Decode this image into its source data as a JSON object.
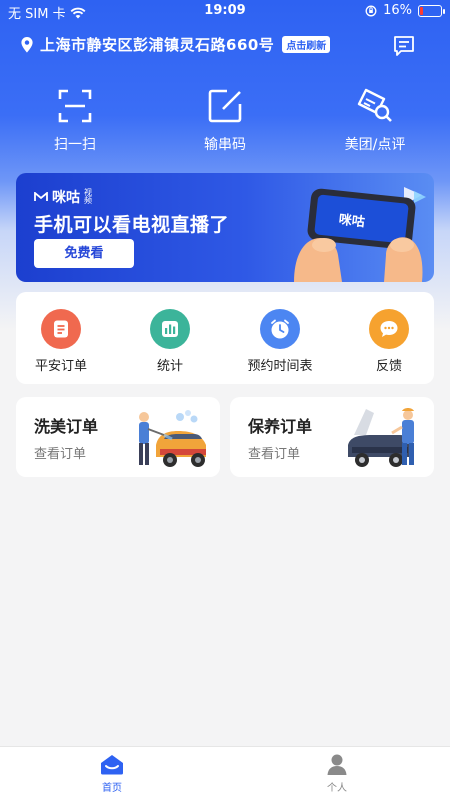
{
  "status": {
    "carrier": "无 SIM 卡",
    "time": "19:09",
    "battery": "16%",
    "battery_level": 0.16
  },
  "location": {
    "address": "上海市静安区彭浦镇灵石路660号",
    "refresh_label": "点击刷新"
  },
  "quick_actions": [
    {
      "label": "扫一扫",
      "icon": "scan-icon"
    },
    {
      "label": "输串码",
      "icon": "edit-code-icon"
    },
    {
      "label": "美团/点评",
      "icon": "voucher-search-icon"
    }
  ],
  "banner": {
    "brand": "咪咕",
    "brand_sub": "视频",
    "title": "手机可以看电视直播了",
    "button_label": "免费看",
    "phone_brand": "咪咕"
  },
  "tools": [
    {
      "label": "平安订单",
      "icon": "document-icon",
      "color": "#f0694f"
    },
    {
      "label": "统计",
      "icon": "bar-chart-icon",
      "color": "#3cb49a"
    },
    {
      "label": "预约时间表",
      "icon": "clock-icon",
      "color": "#4c86f2"
    },
    {
      "label": "反馈",
      "icon": "chat-bubble-icon",
      "color": "#f6a22f"
    }
  ],
  "orders": [
    {
      "title": "洗美订单",
      "subtitle": "查看订单"
    },
    {
      "title": "保养订单",
      "subtitle": "查看订单"
    }
  ],
  "tabbar": {
    "tabs": [
      {
        "label": "首页",
        "active": true
      },
      {
        "label": "个人",
        "active": false
      }
    ],
    "active_color": "#2e62f2",
    "inactive_color": "#888888"
  }
}
